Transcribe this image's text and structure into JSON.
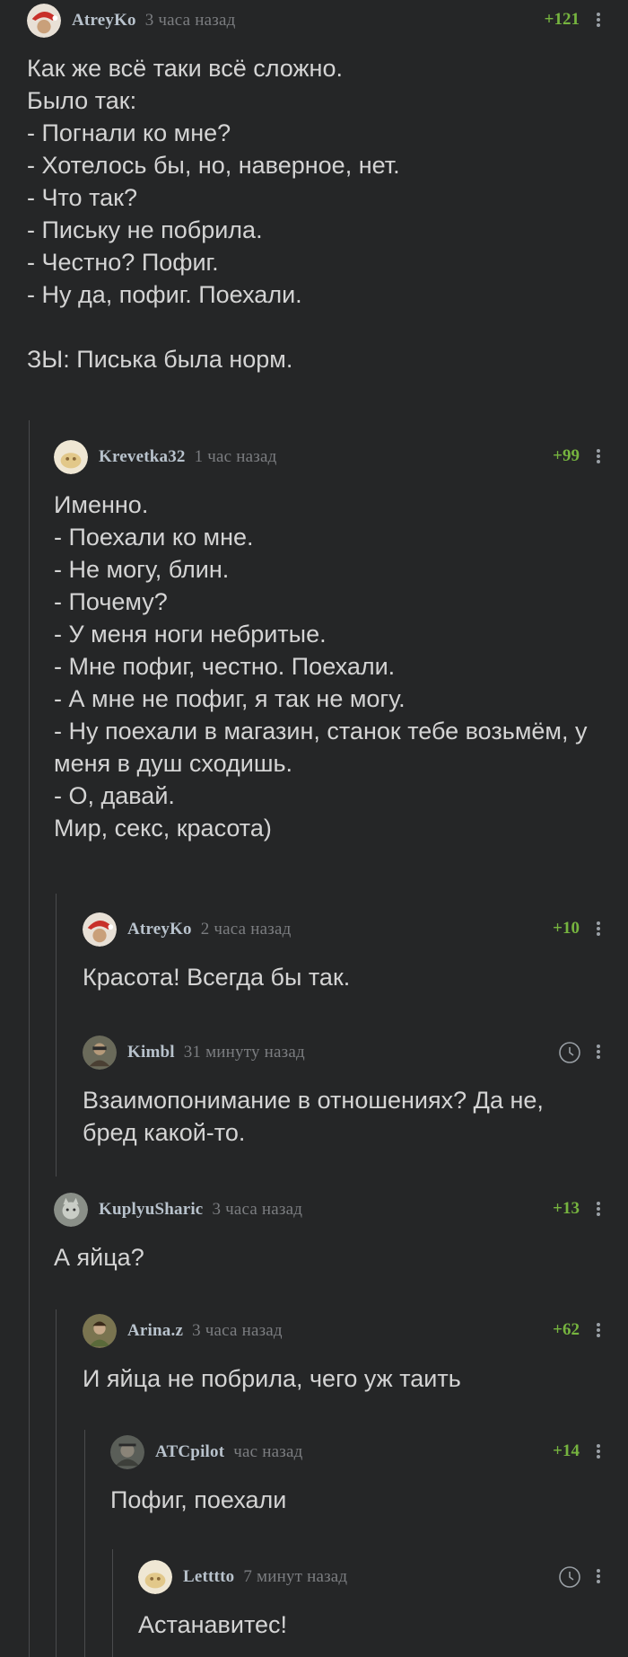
{
  "comments": [
    {
      "author": "AtreyKo",
      "time": "3 часа назад",
      "rating": "+121",
      "text": "Как же всё таки всё сложно.\nБыло так:\n- Погнали ко мне?\n- Хотелось бы, но, наверное, нет.\n- Что так?\n- Письку не побрила.\n- Честно? Пофиг.\n- Ну да, пофиг. Поехали.\n\nЗЫ: Писька была норм."
    },
    {
      "author": "Krevetka32",
      "time": "1 час назад",
      "rating": "+99",
      "text": "Именно.\n- Поехали ко мне.\n- Не могу, блин.\n- Почему?\n- У меня ноги небритые.\n- Мне пофиг, честно. Поехали.\n- А мне не пофиг, я так не могу.\n- Ну поехали в магазин, станок тебе возьмём, у меня в душ сходишь.\n- О, давай.\nМир, секс, красота)"
    },
    {
      "author": "AtreyKo",
      "time": "2 часа назад",
      "rating": "+10",
      "text": "Красота! Всегда бы так."
    },
    {
      "author": "Kimbl",
      "time": "31 минуту назад",
      "rating": "",
      "text": "Взаимопонимание в отношениях? Да не, бред какой-то."
    },
    {
      "author": "KuplyuSharic",
      "time": "3 часа назад",
      "rating": "+13",
      "text": "А яйца?"
    },
    {
      "author": "Arina.z",
      "time": "3 часа назад",
      "rating": "+62",
      "text": "И яйца не побрила, чего уж таить"
    },
    {
      "author": "ATCpilot",
      "time": "час назад",
      "rating": "+14",
      "text": "Пофиг, поехали"
    },
    {
      "author": "Letttto",
      "time": "7 минут назад",
      "rating": "",
      "text": "Астанавитес!"
    }
  ],
  "colors": {
    "background": "#252627",
    "rating": "#76b43f",
    "author": "#b8c2cc",
    "time": "#7b7d80",
    "text": "#d4d4d4",
    "thread_line": "#4a4b4d"
  },
  "icons": {
    "menu": "vertical-ellipsis-icon",
    "pending_rating": "clock-icon"
  }
}
